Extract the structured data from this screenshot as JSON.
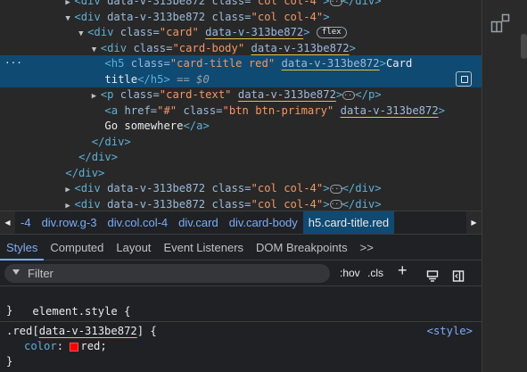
{
  "tree": {
    "rows": [
      {
        "indent": "          ",
        "arrow": "▶",
        "open": "<div",
        "attr": "data-v-313be872",
        "cls_attr": "class=",
        "cls_val": "\"col col-4\"",
        "close": ">",
        "ell": "···",
        "end": "</div>"
      },
      {
        "indent": "          ",
        "arrow": "▼",
        "open": "<div",
        "attr": "data-v-313be872",
        "cls_attr": "class=",
        "cls_val": "\"col col-4\"",
        "close": ">"
      },
      {
        "indent": "            ",
        "arrow": "▼",
        "open": "<div",
        "cls_attr": "class=",
        "cls_val": "\"card\"",
        "dv": "data-v-313be872",
        "close": ">",
        "badge": "flex"
      },
      {
        "indent": "              ",
        "arrow": "▼",
        "open": "<div",
        "cls_attr": "class=",
        "cls_val": "\"card-body\"",
        "dv": "data-v-313be872",
        "close": ">"
      },
      {
        "indent": "                ",
        "open": "<h5",
        "cls_attr": "class=",
        "cls_val": "\"card-title red\"",
        "dv": "data-v-313be872",
        "close": ">",
        "text": "Card"
      },
      {
        "indent": "                ",
        "text": "title",
        "endtag": "</h5>",
        "eq": " == ",
        "dollar": "$0"
      },
      {
        "indent": "              ",
        "arrow": "▶",
        "open": "<p",
        "cls_attr": "class=",
        "cls_val": "\"card-text\"",
        "dv": "data-v-313be872",
        "close": ">",
        "ell": "···",
        "end": "</p>"
      },
      {
        "indent": "                ",
        "open": "<a",
        "href_attr": "href=",
        "href_val": "\"#\"",
        "cls_attr": "class=",
        "cls_val": "\"btn btn-primary\"",
        "dv": "data-v-313be872",
        "close": ">"
      },
      {
        "indent": "                ",
        "text": "Go somewhere",
        "endtag": "</a>"
      },
      {
        "indent": "              ",
        "endtag": "</div>"
      },
      {
        "indent": "            ",
        "endtag": "</div>"
      },
      {
        "indent": "          ",
        "endtag": "</div>"
      },
      {
        "indent": "          ",
        "arrow": "▶",
        "open": "<div",
        "attr": "data-v-313be872",
        "cls_attr": "class=",
        "cls_val": "\"col col-4\"",
        "close": ">",
        "ell": "···",
        "end": "</div>"
      },
      {
        "indent": "          ",
        "arrow": "▶",
        "open": "<div",
        "attr": "data-v-313be872",
        "cls_attr": "class=",
        "cls_val": "\"col col-4\"",
        "close": ">",
        "ell": "···",
        "end": "</div>"
      }
    ],
    "selected_dots": "···"
  },
  "breadcrumb": {
    "prev": "◀",
    "next": "▶",
    "items": [
      "-4",
      "div.row.g-3",
      "div.col.col-4",
      "div.card",
      "div.card-body",
      "h5.card-title.red"
    ]
  },
  "tabs": [
    "Styles",
    "Computed",
    "Layout",
    "Event Listeners",
    "DOM Breakpoints",
    ">>"
  ],
  "filter": {
    "placeholder": "Filter",
    "hov": ":hov",
    "cls": ".cls",
    "plus": "+"
  },
  "styles": {
    "element_style": "element.style {",
    "close_brace": "}",
    "rule_selector_prefix": ".red[",
    "rule_selector_attr": "data-v-313be872",
    "rule_selector_suffix": "] {",
    "prop_name": "color",
    "prop_value": "red;",
    "source": "<style>",
    "swatch_color": "#ff0000"
  },
  "colors": {
    "selected_row": "#0f4a73",
    "accent": "#7cacf8",
    "underline": "#e0c24a"
  }
}
